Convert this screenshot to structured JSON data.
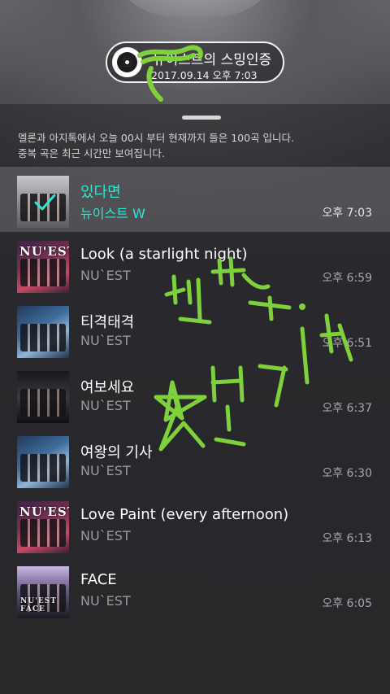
{
  "certificate": {
    "title": "뉴이스트의 스밍인증",
    "datetime": "2017.09.14 오후 7:03",
    "icon": "disc-icon"
  },
  "info": {
    "line1": "멜론과 아지톡에서 오늘 00시 부터 현재까지 들은 100곡 입니다.",
    "line2": "중복 곡은 최근 시간만 보여집니다."
  },
  "songs": [
    {
      "title": "있다면",
      "artist": "뉴이스트 W",
      "time": "오후 7:03",
      "active": true
    },
    {
      "title": "Look (a starlight night)",
      "artist": "NU`EST",
      "time": "오후 6:59",
      "cover_text": "NU'EST"
    },
    {
      "title": "티격태격",
      "artist": "NU`EST",
      "time": "오후 6:51"
    },
    {
      "title": "여보세요",
      "artist": "NU`EST",
      "time": "오후 6:37"
    },
    {
      "title": "여왕의 기사",
      "artist": "NU`EST",
      "time": "오후 6:30"
    },
    {
      "title": "Love Paint (every afternoon)",
      "artist": "NU`EST",
      "time": "오후 6:13",
      "cover_text": "NU'EST"
    },
    {
      "title": "FACE",
      "artist": "NU`EST",
      "time": "오후 6:05",
      "cover_text": "NU'EST FACE"
    }
  ],
  "colors": {
    "active_text": "#2ee7d3",
    "annotation": "#7fd13b"
  },
  "annotation_text": "팬톡 ☆받기"
}
